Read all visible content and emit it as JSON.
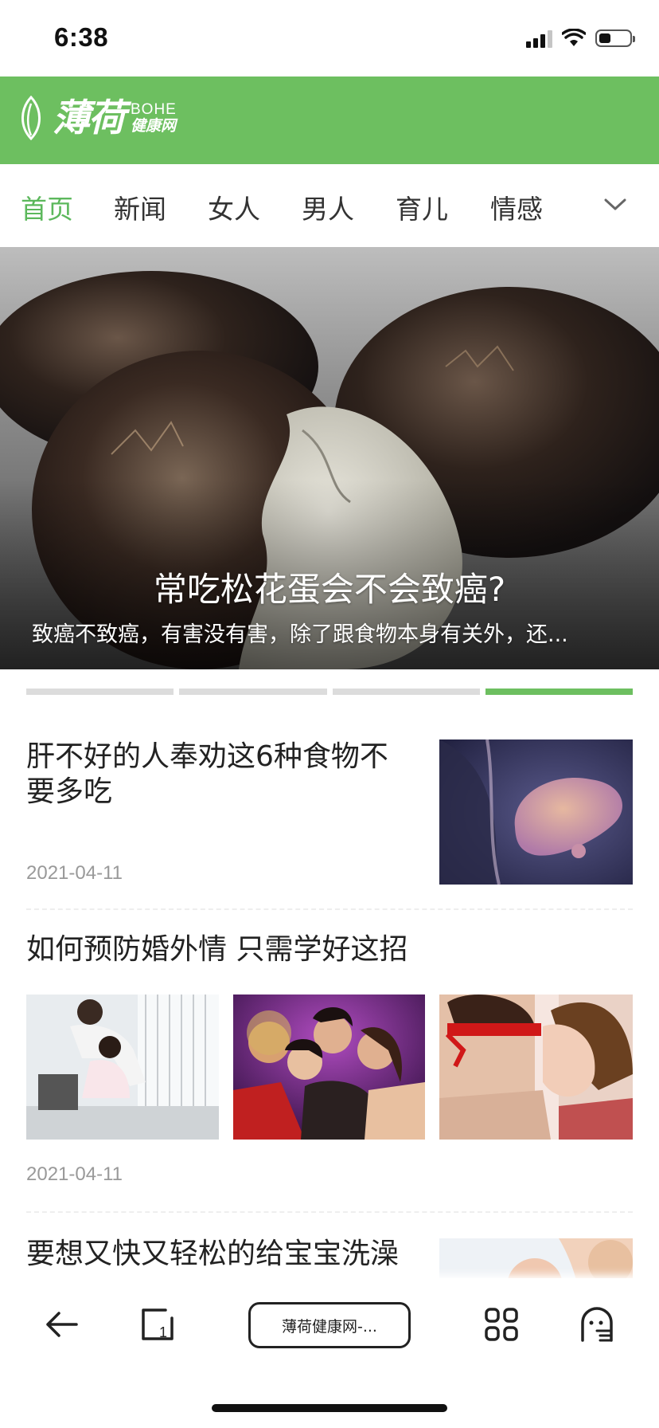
{
  "status_bar": {
    "time": "6:38"
  },
  "header": {
    "logo_main": "薄荷",
    "logo_sub_en": "BOHE",
    "logo_sub_cn": "健康网",
    "brand_color": "#6dbf60"
  },
  "nav": {
    "tabs": [
      {
        "label": "首页",
        "active": true
      },
      {
        "label": "新闻",
        "active": false
      },
      {
        "label": "女人",
        "active": false
      },
      {
        "label": "男人",
        "active": false
      },
      {
        "label": "育儿",
        "active": false
      },
      {
        "label": "情感",
        "active": false
      }
    ],
    "expand_icon": "chevron-down-icon",
    "active_color": "#5cb85c"
  },
  "hero": {
    "title": "常吃松花蛋会不会致癌?",
    "description": "致癌不致癌，有害没有害，除了跟食物本身有关外，还...",
    "image": "preserved-eggs-photo"
  },
  "carousel": {
    "count": 4,
    "active_index": 3
  },
  "articles": [
    {
      "title": "肝不好的人奉劝这6种食物不要多吃",
      "date": "2021-04-11",
      "images": [
        "liver-illustration"
      ]
    },
    {
      "title": "如何预防婚外情 只需学好这招",
      "date": "2021-04-11",
      "images": [
        "office-couple-photo",
        "party-group-photo",
        "blindfold-couple-photo"
      ]
    },
    {
      "title": "要想又快又轻松的给宝宝洗澡",
      "images": [
        "baby-bath-photo"
      ]
    }
  ],
  "bottom_bar": {
    "back_icon": "back-arrow-icon",
    "tabs_icon": "tabs-icon",
    "url_text": "薄荷健康网-...",
    "apps_icon": "grid-icon",
    "incognito_icon": "incognito-icon"
  }
}
